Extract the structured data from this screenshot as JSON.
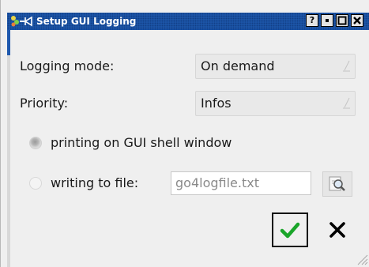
{
  "window": {
    "title": "Setup GUI Logging",
    "titlebar_color": "#1e58ad",
    "buttons": {
      "help_label": "?",
      "minimize_icon": "minimize-icon",
      "maximize_icon": "maximize-icon",
      "close_icon": "close-icon"
    }
  },
  "form": {
    "logging_mode_label": "Logging mode:",
    "logging_mode_value": "On demand",
    "priority_label": "Priority:",
    "priority_value": "Infos",
    "radio_shell_label": "printing on GUI shell window",
    "radio_shell_checked": true,
    "radio_file_label": "writing to file:",
    "radio_file_checked": false,
    "file_name": "go4logfile.txt",
    "browse_icon": "magnifier-icon"
  },
  "actions": {
    "ok_icon": "checkmark-icon",
    "ok_color": "#1aa52a",
    "cancel_icon": "x-icon"
  }
}
